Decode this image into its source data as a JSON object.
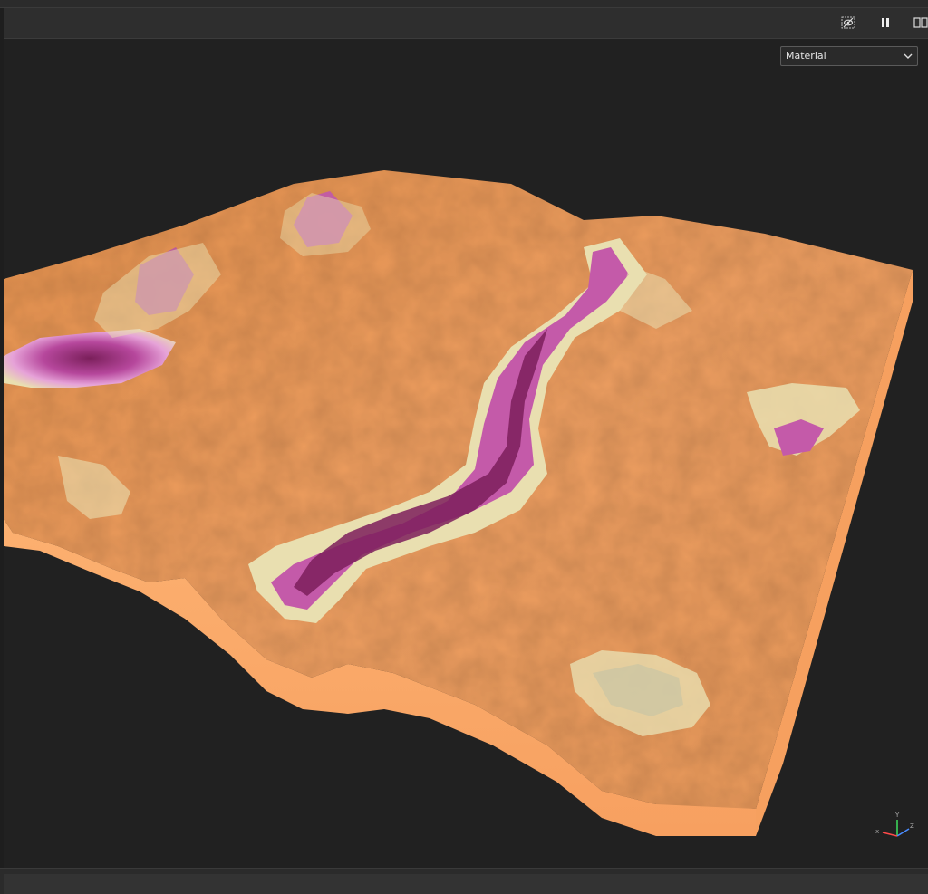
{
  "viewport": {
    "render_mode": {
      "selected": "Material"
    }
  },
  "gizmo": {
    "x_label": "x",
    "y_label": "Y",
    "z_label": "Z"
  },
  "colors": {
    "background": "#212121",
    "terrain_high": "#f09a55",
    "terrain_mid": "#e9dfb0",
    "terrain_low": "#c04fa6",
    "terrain_deep": "#7a1f5a",
    "wall": "#fca66a"
  },
  "icons": {
    "hide": "eye-off-icon",
    "pause": "pause-icon",
    "split": "split-view-icon",
    "dropdown": "chevron-down-icon"
  }
}
